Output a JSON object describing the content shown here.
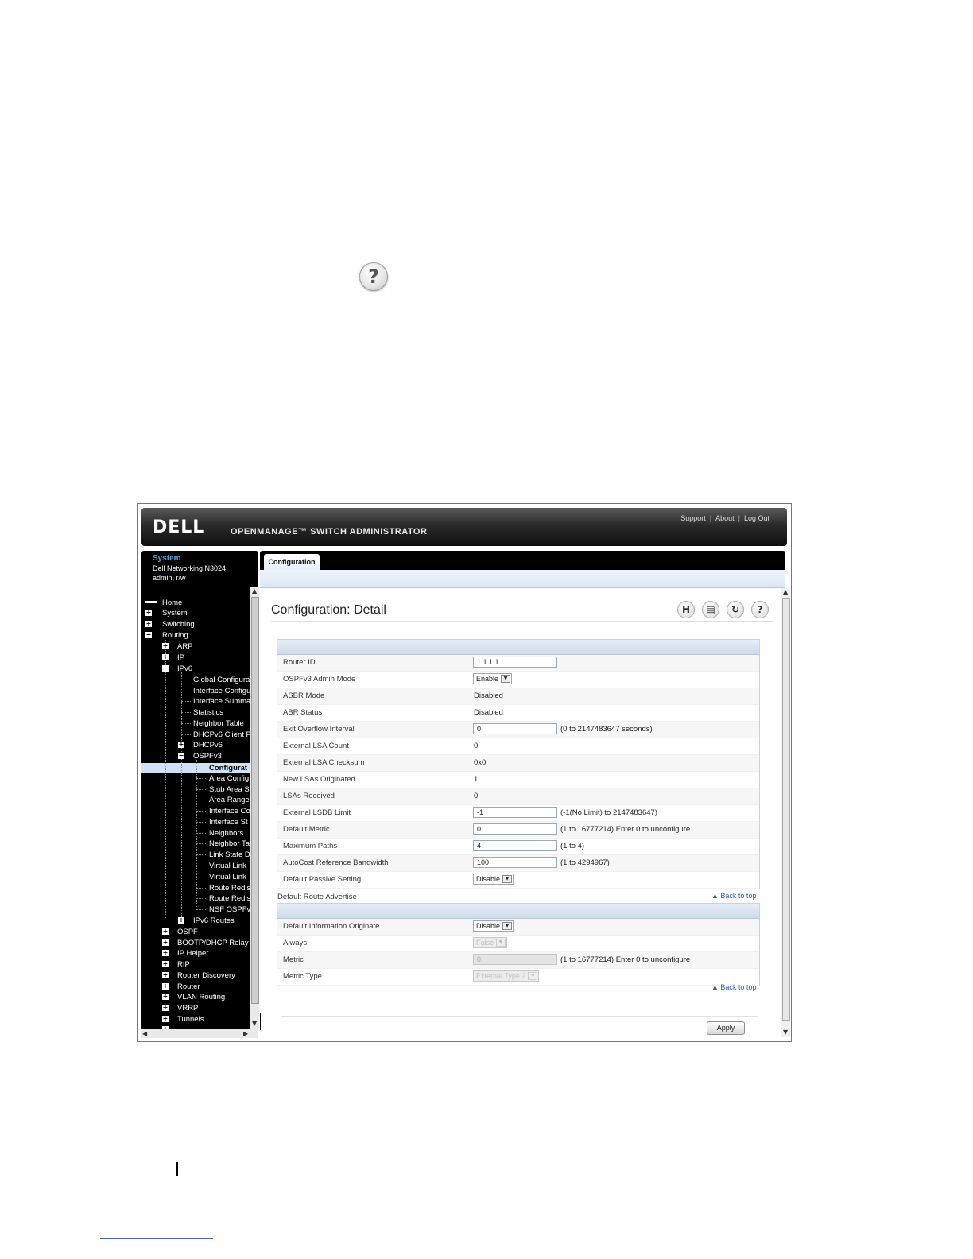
{
  "banner": {
    "logo": "DELL",
    "product": "OPENMANAGE™ SWITCH ADMINISTRATOR",
    "links": [
      "Support",
      "About",
      "Log Out"
    ]
  },
  "system": {
    "title": "System",
    "model": "Dell Networking N3024",
    "user": "admin, r/w"
  },
  "nav": {
    "home": "Home",
    "system": "System",
    "switching": "Switching",
    "routing": "Routing",
    "arp": "ARP",
    "ip": "IP",
    "ipv6": "IPv6",
    "global_config": "Global Configura",
    "interface_config": "Interface Configu",
    "interface_summary": "Interface Summa",
    "statistics": "Statistics",
    "neighbor_table": "Neighbor Table",
    "dhcpv6_client": "DHCPv6 Client P",
    "dhcpv6": "DHCPv6",
    "ospfv3": "OSPFv3",
    "configuration": "Configurat",
    "area_config": "Area Config",
    "stub_area": "Stub Area S",
    "area_range": "Area Range",
    "interface_co": "Interface Co",
    "interface_st": "Interface St",
    "neighbors": "Neighbors",
    "neighbor_ta": "Neighbor Ta",
    "link_state": "Link State D",
    "virtual_link1": "Virtual Link",
    "virtual_link2": "Virtual Link",
    "route_redis1": "Route Redis",
    "route_redis2": "Route Redis",
    "nsf_ospfv": "NSF OSPFv",
    "ipv6_routes": "IPv6 Routes",
    "ospf": "OSPF",
    "bootp": "BOOTP/DHCP Relay",
    "ip_helper": "IP Helper",
    "rip": "RIP",
    "router_discovery": "Router Discovery",
    "router": "Router",
    "vlan_routing": "VLAN Routing",
    "vrrp": "VRRP",
    "tunnels": "Tunnels"
  },
  "tabs": {
    "active": "Configuration"
  },
  "page": {
    "title": "Configuration: Detail"
  },
  "detail": {
    "router_id_label": "Router ID",
    "router_id_value": "1.1.1.1",
    "admin_mode_label": "OSPFv3 Admin Mode",
    "admin_mode_value": "Enable",
    "asbr_label": "ASBR Mode",
    "asbr_value": "Disabled",
    "abr_label": "ABR Status",
    "abr_value": "Disabled",
    "exit_overflow_label": "Exit Overflow Interval",
    "exit_overflow_value": "0",
    "exit_overflow_hint": "(0 to 2147483647 seconds)",
    "ext_lsa_count_label": "External LSA Count",
    "ext_lsa_count_value": "0",
    "ext_lsa_checksum_label": "External LSA Checksum",
    "ext_lsa_checksum_value": "0x0",
    "new_lsas_label": "New LSAs Originated",
    "new_lsas_value": "1",
    "lsas_received_label": "LSAs Received",
    "lsas_received_value": "0",
    "ext_lsdb_label": "External LSDB Limit",
    "ext_lsdb_value": "-1",
    "ext_lsdb_hint": "(-1(No Limit) to 2147483647)",
    "default_metric_label": "Default Metric",
    "default_metric_value": "0",
    "default_metric_hint": "(1 to 16777214) Enter 0 to unconfigure",
    "max_paths_label": "Maximum Paths",
    "max_paths_value": "4",
    "max_paths_hint": "(1 to 4)",
    "autocost_label": "AutoCost Reference Bandwidth",
    "autocost_value": "100",
    "autocost_hint": "(1 to 4294967)",
    "passive_label": "Default Passive Setting",
    "passive_value": "Disable"
  },
  "route_advertise": {
    "section_title": "Default Route Advertise",
    "back_to_top": "Back to top",
    "originate_label": "Default Information Originate",
    "originate_value": "Disable",
    "always_label": "Always",
    "always_value": "False",
    "metric_label": "Metric",
    "metric_value": "0",
    "metric_hint": "(1 to 16777214) Enter 0 to unconfigure",
    "metric_type_label": "Metric Type",
    "metric_type_value": "External Type 2"
  },
  "actions": {
    "apply": "Apply"
  },
  "icons": {
    "save": "save-icon",
    "print": "print-icon",
    "refresh": "refresh-icon",
    "help": "help-icon"
  }
}
